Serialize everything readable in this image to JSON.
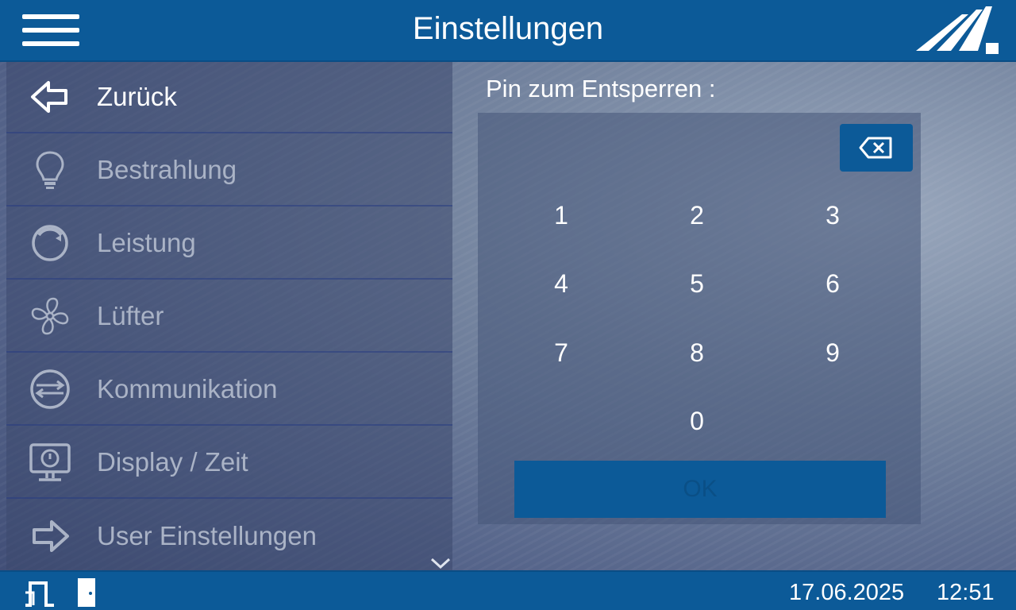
{
  "header": {
    "title": "Einstellungen",
    "menu_icon": "hamburger-icon",
    "logo_icon": "brand-logo"
  },
  "menu": {
    "items": [
      {
        "label": "Zurück",
        "icon": "arrow-left-icon",
        "state": "active"
      },
      {
        "label": "Bestrahlung",
        "icon": "lightbulb-icon",
        "state": "dim"
      },
      {
        "label": "Leistung",
        "icon": "power-gauge-icon",
        "state": "dim"
      },
      {
        "label": "Lüfter",
        "icon": "fan-icon",
        "state": "dim"
      },
      {
        "label": "Kommunikation",
        "icon": "communication-icon",
        "state": "dim"
      },
      {
        "label": "Display / Zeit",
        "icon": "display-clock-icon",
        "state": "dim"
      },
      {
        "label": "User Einstellungen",
        "icon": "arrow-right-icon",
        "state": "dim"
      }
    ],
    "scroll_icon": "chevron-down-icon"
  },
  "pin": {
    "label": "Pin zum Entsperren :",
    "keys": [
      "1",
      "2",
      "3",
      "4",
      "5",
      "6",
      "7",
      "8",
      "9",
      "0"
    ],
    "ok_label": "OK",
    "backspace_icon": "backspace-icon"
  },
  "status": {
    "date": "17.06.2025",
    "time": "12:51",
    "signal_icon": "pulse-signal-icon",
    "door_icon": "door-icon"
  },
  "colors": {
    "accent": "#0c5a98",
    "text_dim": "#aab3c6"
  }
}
